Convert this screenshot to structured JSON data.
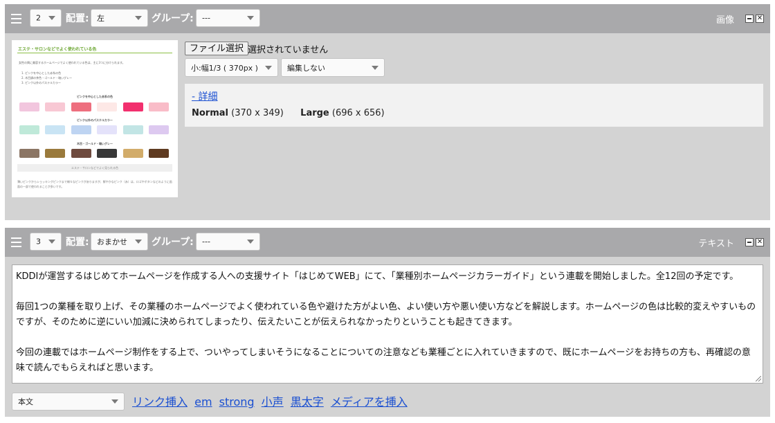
{
  "blocks": [
    {
      "order_value": "2",
      "placement_label": "配置:",
      "placement_value": "左",
      "group_label": "グループ:",
      "group_value": "---",
      "type_label": "画像",
      "close_glyph": "✕",
      "file_button": "ファイル選択",
      "file_status": "選択されていません",
      "size_select": "小:幅1/3 ( 370px )",
      "edit_select": "編集しない",
      "detail_link": "- 詳細",
      "sizes": [
        {
          "name": "Normal",
          "dim": "(370 x 349)"
        },
        {
          "name": "Large",
          "dim": "(696 x 656)"
        }
      ],
      "thumbnail": {
        "title": "エステ・サロンなどでよく使われている色",
        "intro": "女性の興に美容するホームページでよく使われている色は、主に3つに分けられます。",
        "list": [
          "1. ピンクを中心とした赤系の色",
          "2. 木目調の茶色・ゴールド・暗いグレー",
          "3. ピンク以外のパステルカラー"
        ],
        "section1": "ピンクを中心とした赤系の色",
        "section2": "ピンク以外のパステルカラー",
        "section3": "木目・ゴールド・暗いグレー",
        "caption": "エステ・サロンなどでよく見られる色",
        "footer": "薄いピンクからショッキングピンクまで様々なピンクがありますが、鮮やかなピンク（赤）は、ロゴやボタンなどのように画面の一部で使われることが多いです。",
        "swatch_rows": [
          [
            "#f2c6de",
            "#f8c8d4",
            "#ee6f7f",
            "#fde8e6",
            "#f2306e",
            "#f9bcc8"
          ],
          [
            "#bfe9d9",
            "#c9e4f4",
            "#bed4f2",
            "#e4e2fa",
            "#c2e5e5",
            "#ddc9f0"
          ],
          [
            "#8b7564",
            "#9a7a3c",
            "#6e4a3e",
            "#383838",
            "#d2ac6a",
            "#5e3a20"
          ]
        ]
      }
    },
    {
      "order_value": "3",
      "placement_label": "配置:",
      "placement_value": "おまかせ",
      "group_label": "グループ:",
      "group_value": "---",
      "type_label": "テキスト",
      "close_glyph": "✕",
      "paragraphs": [
        "KDDIが運営するはじめてホームページを作成する人への支援サイト「はじめてWEB」にて、「業種別ホームページカラーガイド」という連載を開始しました。全12回の予定です。",
        "毎回1つの業種を取り上げ、その業種のホームページでよく使われている色や避けた方がよい色、よい使い方や悪い使い方などを解説します。ホームページの色は比較的変えやすいものですが、そのために逆にいい加減に決められてしまったり、伝えたいことが伝えられなかったりということも起きてきます。",
        "今回の連載ではホームページ制作をする上で、ついやってしまいそうになることについての注意なども業種ごとに入れていきますので、既にホームページをお持ちの方も、再確認の意味で読んでもらえればと思います。"
      ],
      "format_select": "本文",
      "toolbar_links": [
        "リンク挿入",
        "em",
        "strong",
        "小声",
        "黒太字",
        "メディアを挿入"
      ]
    }
  ],
  "colors": {
    "header_bg": "#a9a9ab",
    "body_bg": "#d3d3d3",
    "link": "#1a4fd1"
  }
}
